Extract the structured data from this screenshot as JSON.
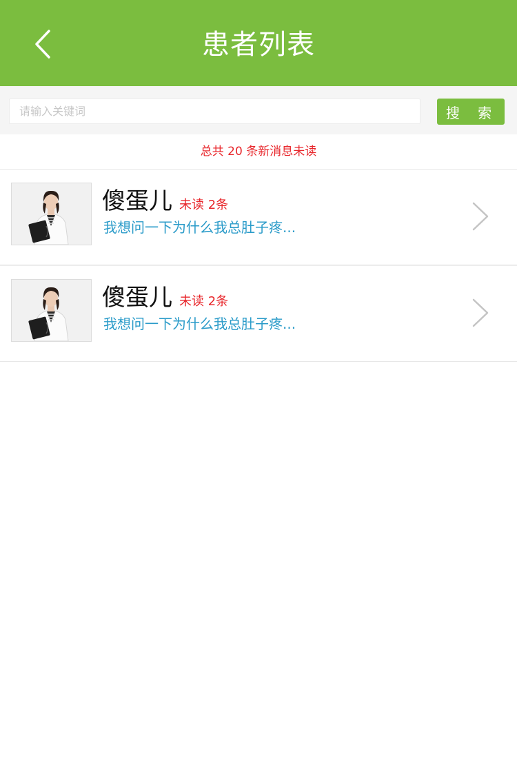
{
  "header": {
    "title": "患者列表",
    "back_icon": "chevron-left-icon"
  },
  "search": {
    "placeholder": "请输入关键词",
    "value": "",
    "button_label": "搜 索"
  },
  "banner": {
    "text": "总共 20 条新消息未读"
  },
  "patients": [
    {
      "name": "傻蛋儿",
      "unread": "未读 2条",
      "preview": "我想问一下为什么我总肚子疼...",
      "avatar_icon": "doctor-avatar"
    },
    {
      "name": "傻蛋儿",
      "unread": "未读 2条",
      "preview": "我想问一下为什么我总肚子疼...",
      "avatar_icon": "doctor-avatar"
    }
  ],
  "colors": {
    "accent": "#7bbd3f",
    "unread": "#e8262b",
    "preview": "#2a9bc9"
  }
}
